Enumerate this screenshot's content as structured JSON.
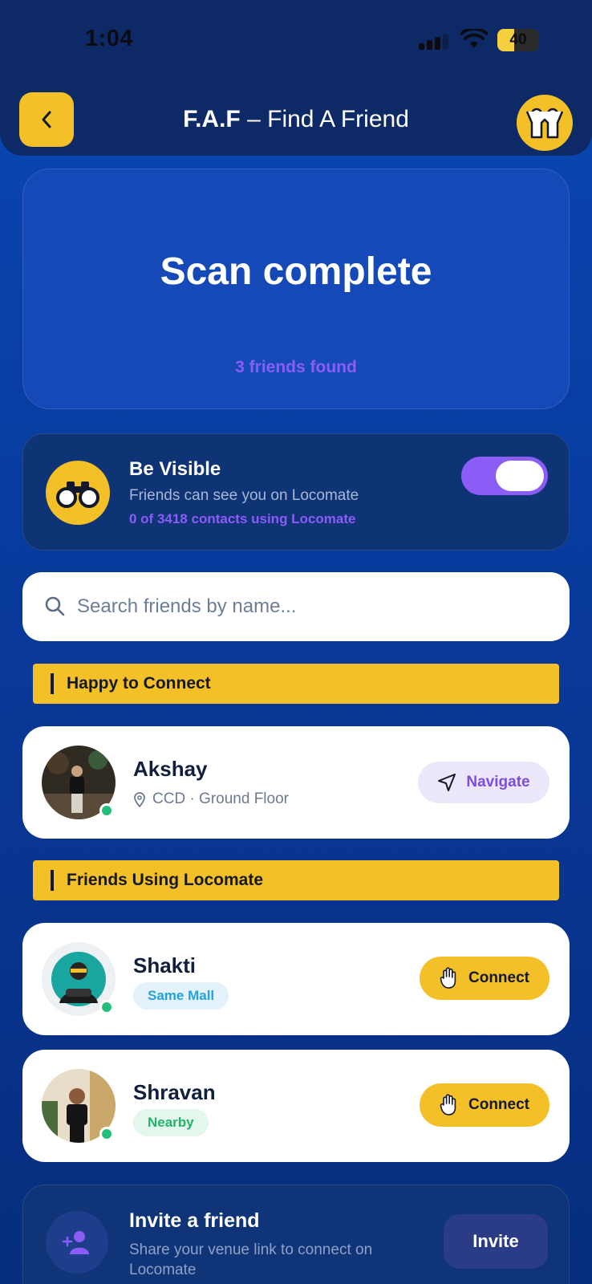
{
  "status_bar": {
    "time": "1:04",
    "battery": "40",
    "battery_level": 0.4
  },
  "header": {
    "title_bold": "F.A.F",
    "title_rest": " – Find A Friend"
  },
  "scan": {
    "title": "Scan complete",
    "subtitle": "3 friends found"
  },
  "visibility": {
    "title": "Be Visible",
    "subtitle": "Friends can see you on Locomate",
    "count": "0 of 3418 contacts using Locomate",
    "toggle_on": true
  },
  "search": {
    "placeholder": "Search friends by name..."
  },
  "sections": [
    {
      "label": "Happy to Connect"
    },
    {
      "label": "Friends Using Locomate"
    }
  ],
  "happy": [
    {
      "name": "Akshay",
      "location": "CCD · Ground Floor",
      "action": "Navigate"
    }
  ],
  "friends": [
    {
      "name": "Shakti",
      "tag": "Same Mall",
      "action": "Connect"
    },
    {
      "name": "Shravan",
      "tag": "Nearby",
      "action": "Connect"
    }
  ],
  "invite": {
    "title": "Invite a friend",
    "subtitle": "Share your venue link to connect on Locomate",
    "button": "Invite"
  },
  "colors": {
    "accent_yellow": "#f3c027",
    "accent_purple": "#8b5cf6",
    "online_green": "#22c07a"
  }
}
